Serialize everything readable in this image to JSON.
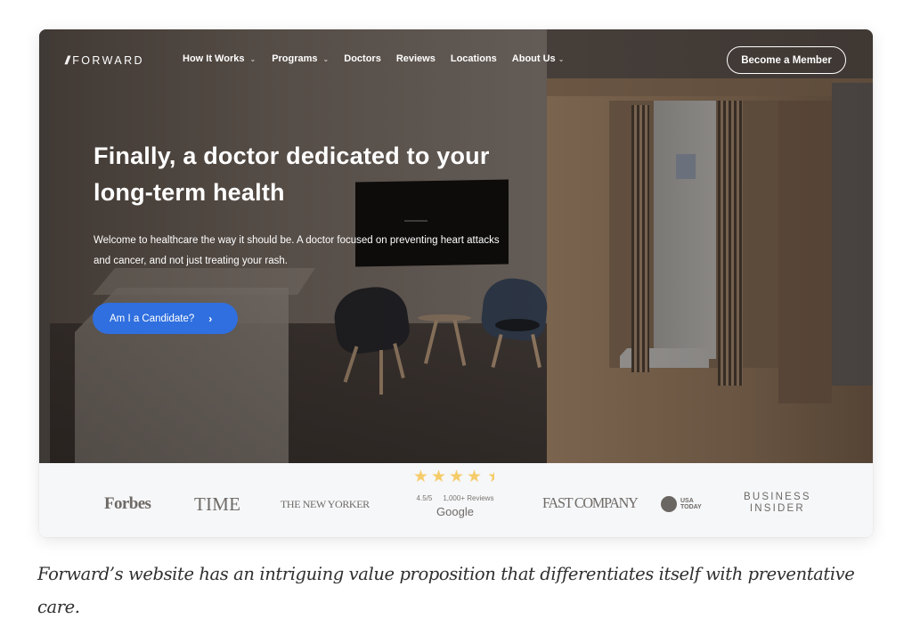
{
  "nav": {
    "logo_mark": "//",
    "logo_text": "FORWARD",
    "links": [
      {
        "label": "How It Works",
        "dropdown": true
      },
      {
        "label": "Programs",
        "dropdown": true
      },
      {
        "label": "Doctors",
        "dropdown": false
      },
      {
        "label": "Reviews",
        "dropdown": false
      },
      {
        "label": "Locations",
        "dropdown": false
      },
      {
        "label": "About Us",
        "dropdown": true
      }
    ],
    "chevron": "⌄",
    "cta_label": "Become a Member"
  },
  "hero": {
    "headline": "Finally, a doctor dedicated to your long-term health",
    "subtext": "Welcome to healthcare the way it should be. A doctor focused on preventing heart attacks and cancer, and not just treating your rash.",
    "button_label": "Am I a Candidate?",
    "button_chevron": "›",
    "button_color": "#2f6fdf"
  },
  "press": {
    "logos": {
      "forbes": "Forbes",
      "time": "TIME",
      "newyorker": "THE NEW YORKER",
      "fastcompany": "FAST COMPANY",
      "usatoday_line1": "USA",
      "usatoday_line2": "TODAY",
      "businessinsider_line1": "BUSINESS",
      "businessinsider_line2": "INSIDER"
    },
    "rating": {
      "stars": 4.5,
      "score_text": "4.5/5",
      "reviews_text": "1,000+ Reviews",
      "source": "Google",
      "star_color": "#f5cc6a"
    }
  },
  "caption": "Forward’s website has an  intriguing value proposition that differentiates itself with preventative care."
}
